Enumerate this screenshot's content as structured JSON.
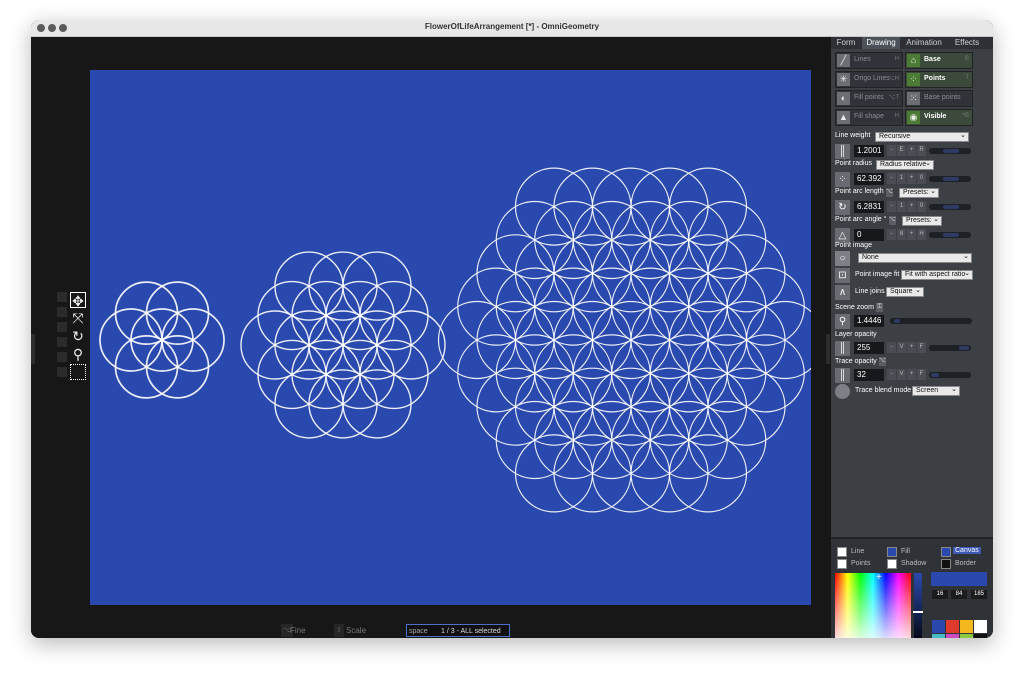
{
  "window": {
    "title": "FlowerOfLifeArrangement [*] - OmniGeometry"
  },
  "tabs": [
    "Form",
    "Drawing",
    "Animation",
    "Effects"
  ],
  "active_tab": "Drawing",
  "toggles": [
    {
      "label": "Lines",
      "key": "H",
      "on": false,
      "icon": "lines-icon"
    },
    {
      "label": "Base",
      "key": "B",
      "on": true,
      "icon": "base-icon"
    },
    {
      "label": "Origo Lines",
      "key": "⌥H",
      "on": false,
      "icon": "origo-lines-icon"
    },
    {
      "label": "Points",
      "key": "T",
      "on": true,
      "icon": "points-icon"
    },
    {
      "label": "Fill points",
      "key": "⌥T",
      "on": false,
      "icon": "fill-points-icon"
    },
    {
      "label": "Base points",
      "key": "",
      "on": false,
      "icon": "base-points-icon"
    },
    {
      "label": "Fill shape",
      "key": "H",
      "on": false,
      "icon": "fill-shape-icon"
    },
    {
      "label": "Visible",
      "key": "^B",
      "on": true,
      "icon": "eye-icon"
    }
  ],
  "properties": {
    "line_weight": {
      "label": "Line weight",
      "mode": "Recursive",
      "value": "1.2001",
      "dec_key": "E",
      "inc_key": "R"
    },
    "point_radius": {
      "label": "Point radius",
      "mode": "Radius relative",
      "value": "62.392",
      "dec_key": "1",
      "inc_key": "0"
    },
    "point_arc_length": {
      "label": "Point arc length",
      "presets": "Presets:",
      "value": "6.2831",
      "dec_key": "1",
      "inc_key": "0"
    },
    "point_arc_angle": {
      "label": "Point arc angle °",
      "presets": "Presets:",
      "value": "0",
      "dec_key": "8",
      "inc_key": "H"
    },
    "point_image": {
      "label": "Point image",
      "value": "None"
    },
    "point_image_fit": {
      "label": "Point image fit",
      "value": "Fit with aspect ratio"
    },
    "line_joins": {
      "label": "Line joins",
      "value": "Square"
    },
    "scene_zoom": {
      "label": "Scene zoom",
      "value": "1.4446"
    },
    "layer_opacity": {
      "label": "Layer opacity",
      "value": "255",
      "dec_key": "V",
      "inc_key": "F"
    },
    "trace_opacity": {
      "label": "Trace opacity",
      "value": "32",
      "dec_key": "V",
      "inc_key": "F"
    },
    "trace_blend_mode": {
      "label": "Trace blend mode",
      "value": "Screen"
    }
  },
  "colors": {
    "swatches": [
      {
        "label": "Line",
        "color": "#ffffff"
      },
      {
        "label": "Fill",
        "color": "#2a49ae"
      },
      {
        "label": "Canvas",
        "color": "#2a49ae",
        "active": true
      },
      {
        "label": "Points",
        "color": "#ffffff"
      },
      {
        "label": "Shadow",
        "color": "#ffffff"
      },
      {
        "label": "Border",
        "color": "#111111"
      }
    ],
    "rgb": [
      "16",
      "84",
      "185"
    ],
    "palette": [
      "#2a49ae",
      "#e03a2c",
      "#f2b81d",
      "#ffffff",
      "#48bdc4",
      "#c94cc0",
      "#8ac940",
      "#111111"
    ]
  },
  "statusbar": {
    "fine_tune": "Fine Tune",
    "scale_rotate": "Scale & Rotate",
    "key": "space",
    "selection": "1 / 3 - ALL selected"
  },
  "canvas": {
    "background": "#2a49ae",
    "stroke": "#ffffff"
  }
}
